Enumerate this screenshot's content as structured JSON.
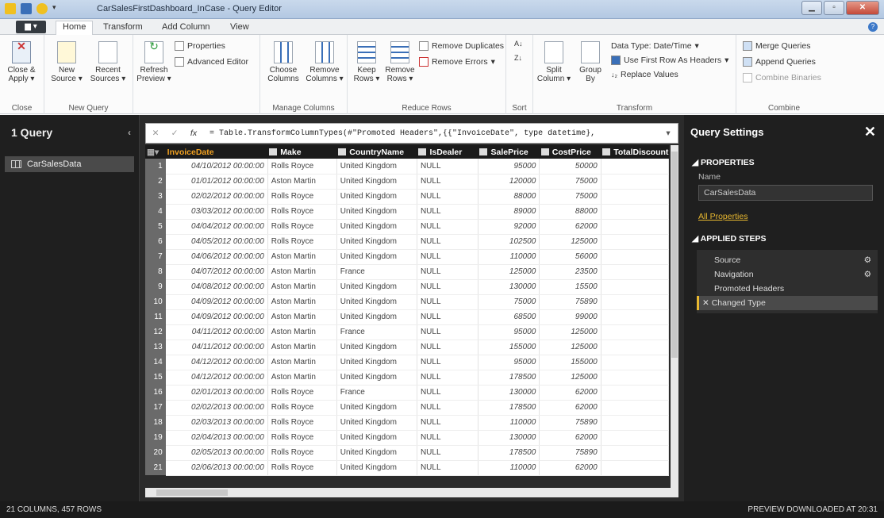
{
  "window": {
    "title": "CarSalesFirstDashboard_InCase - Query Editor"
  },
  "tabs": {
    "file": "",
    "home": "Home",
    "transform": "Transform",
    "add_column": "Add Column",
    "view": "View"
  },
  "ribbon": {
    "close_apply": "Close & Apply",
    "close_group": "Close",
    "new_source": "New Source",
    "recent_sources": "Recent Sources",
    "new_query_group": "New Query",
    "refresh_preview": "Refresh Preview",
    "properties": "Properties",
    "advanced_editor": "Advanced Editor",
    "choose_columns": "Choose Columns",
    "remove_columns": "Remove Columns",
    "manage_columns_group": "Manage Columns",
    "keep_rows": "Keep Rows",
    "remove_rows": "Remove Rows",
    "remove_duplicates": "Remove Duplicates",
    "remove_errors": "Remove Errors",
    "reduce_rows_group": "Reduce Rows",
    "sort_group": "Sort",
    "split_column": "Split Column",
    "group_by": "Group By",
    "data_type": "Data Type: Date/Time",
    "first_row_headers": "Use First Row As Headers",
    "replace_values": "Replace Values",
    "transform_group": "Transform",
    "merge_queries": "Merge Queries",
    "append_queries": "Append Queries",
    "combine_binaries": "Combine Binaries",
    "combine_group": "Combine"
  },
  "left": {
    "header": "1 Query",
    "items": [
      {
        "label": "CarSalesData"
      }
    ]
  },
  "formula": {
    "text": "= Table.TransformColumnTypes(#\"Promoted Headers\",{{\"InvoiceDate\", type datetime},"
  },
  "grid": {
    "columns": [
      "InvoiceDate",
      "Make",
      "CountryName",
      "IsDealer",
      "SalePrice",
      "CostPrice",
      "TotalDiscount"
    ],
    "rows": [
      [
        "1",
        "04/10/2012 00:00:00",
        "Rolls Royce",
        "United Kingdom",
        "NULL",
        "95000",
        "50000",
        ""
      ],
      [
        "2",
        "01/01/2012 00:00:00",
        "Aston Martin",
        "United Kingdom",
        "NULL",
        "120000",
        "75000",
        ""
      ],
      [
        "3",
        "02/02/2012 00:00:00",
        "Rolls Royce",
        "United Kingdom",
        "NULL",
        "88000",
        "75000",
        ""
      ],
      [
        "4",
        "03/03/2012 00:00:00",
        "Rolls Royce",
        "United Kingdom",
        "NULL",
        "89000",
        "88000",
        ""
      ],
      [
        "5",
        "04/04/2012 00:00:00",
        "Rolls Royce",
        "United Kingdom",
        "NULL",
        "92000",
        "62000",
        ""
      ],
      [
        "6",
        "04/05/2012 00:00:00",
        "Rolls Royce",
        "United Kingdom",
        "NULL",
        "102500",
        "125000",
        ""
      ],
      [
        "7",
        "04/06/2012 00:00:00",
        "Aston Martin",
        "United Kingdom",
        "NULL",
        "110000",
        "56000",
        ""
      ],
      [
        "8",
        "04/07/2012 00:00:00",
        "Aston Martin",
        "France",
        "NULL",
        "125000",
        "23500",
        ""
      ],
      [
        "9",
        "04/08/2012 00:00:00",
        "Aston Martin",
        "United Kingdom",
        "NULL",
        "130000",
        "15500",
        ""
      ],
      [
        "10",
        "04/09/2012 00:00:00",
        "Aston Martin",
        "United Kingdom",
        "NULL",
        "75000",
        "75890",
        ""
      ],
      [
        "11",
        "04/09/2012 00:00:00",
        "Aston Martin",
        "United Kingdom",
        "NULL",
        "68500",
        "99000",
        ""
      ],
      [
        "12",
        "04/11/2012 00:00:00",
        "Aston Martin",
        "France",
        "NULL",
        "95000",
        "125000",
        ""
      ],
      [
        "13",
        "04/11/2012 00:00:00",
        "Aston Martin",
        "United Kingdom",
        "NULL",
        "155000",
        "125000",
        ""
      ],
      [
        "14",
        "04/12/2012 00:00:00",
        "Aston Martin",
        "United Kingdom",
        "NULL",
        "95000",
        "155000",
        ""
      ],
      [
        "15",
        "04/12/2012 00:00:00",
        "Aston Martin",
        "United Kingdom",
        "NULL",
        "178500",
        "125000",
        ""
      ],
      [
        "16",
        "02/01/2013 00:00:00",
        "Rolls Royce",
        "France",
        "NULL",
        "130000",
        "62000",
        ""
      ],
      [
        "17",
        "02/02/2013 00:00:00",
        "Rolls Royce",
        "United Kingdom",
        "NULL",
        "178500",
        "62000",
        ""
      ],
      [
        "18",
        "02/03/2013 00:00:00",
        "Rolls Royce",
        "United Kingdom",
        "NULL",
        "110000",
        "75890",
        ""
      ],
      [
        "19",
        "02/04/2013 00:00:00",
        "Rolls Royce",
        "United Kingdom",
        "NULL",
        "130000",
        "62000",
        ""
      ],
      [
        "20",
        "02/05/2013 00:00:00",
        "Rolls Royce",
        "United Kingdom",
        "NULL",
        "178500",
        "75890",
        ""
      ],
      [
        "21",
        "02/06/2013 00:00:00",
        "Rolls Royce",
        "United Kingdom",
        "NULL",
        "110000",
        "62000",
        ""
      ]
    ]
  },
  "settings": {
    "header": "Query Settings",
    "properties_label": "PROPERTIES",
    "name_label": "Name",
    "name_value": "CarSalesData",
    "all_properties": "All Properties",
    "applied_steps_label": "APPLIED STEPS",
    "steps": [
      {
        "label": "Source",
        "gear": true
      },
      {
        "label": "Navigation",
        "gear": true
      },
      {
        "label": "Promoted Headers",
        "gear": false
      },
      {
        "label": "Changed Type",
        "gear": false,
        "selected": true
      }
    ]
  },
  "status": {
    "left": "21 COLUMNS, 457 ROWS",
    "right": "PREVIEW DOWNLOADED AT 20:31"
  },
  "colors": {
    "accent": "#e8b830",
    "dark_bg": "#1f1f1f"
  }
}
